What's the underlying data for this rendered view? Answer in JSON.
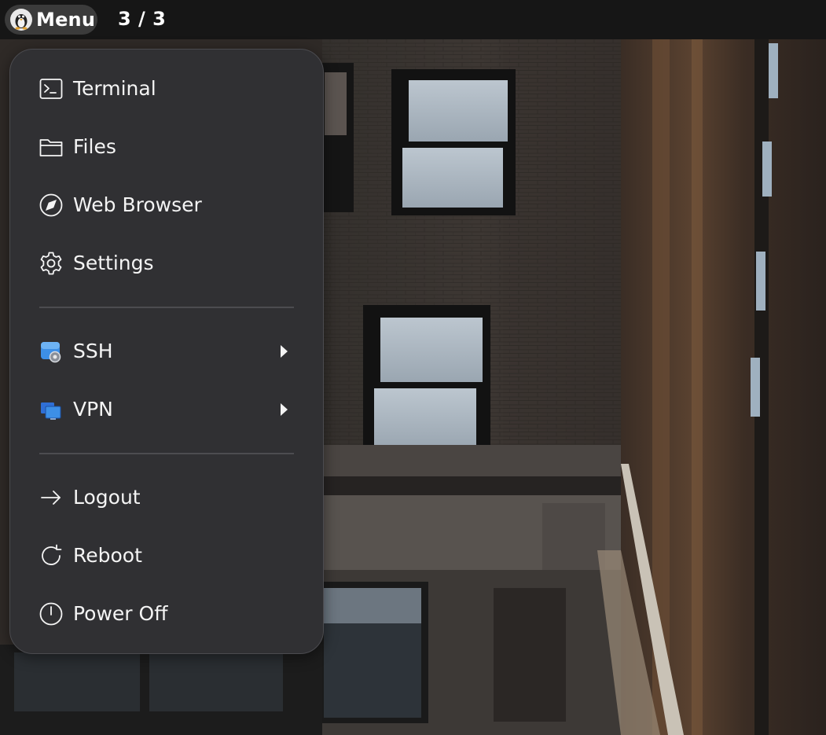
{
  "topbar": {
    "menu_label": "Menu",
    "workspace": "3 / 3"
  },
  "menu": {
    "apps": [
      {
        "label": "Terminal",
        "icon": "terminal-icon"
      },
      {
        "label": "Files",
        "icon": "folder-icon"
      },
      {
        "label": "Web Browser",
        "icon": "compass-icon"
      },
      {
        "label": "Settings",
        "icon": "gear-icon"
      }
    ],
    "network": [
      {
        "label": "SSH",
        "icon": "ssh-icon",
        "has_submenu": true
      },
      {
        "label": "VPN",
        "icon": "vpn-icon",
        "has_submenu": true
      }
    ],
    "session": [
      {
        "label": "Logout",
        "icon": "arrow-right-icon"
      },
      {
        "label": "Reboot",
        "icon": "reboot-icon"
      },
      {
        "label": "Power Off",
        "icon": "power-icon"
      }
    ]
  },
  "colors": {
    "topbar_bg": "#161616",
    "menu_button_bg": "#3b3b3b",
    "popup_bg": "#303033",
    "text": "#f4f4f4"
  }
}
